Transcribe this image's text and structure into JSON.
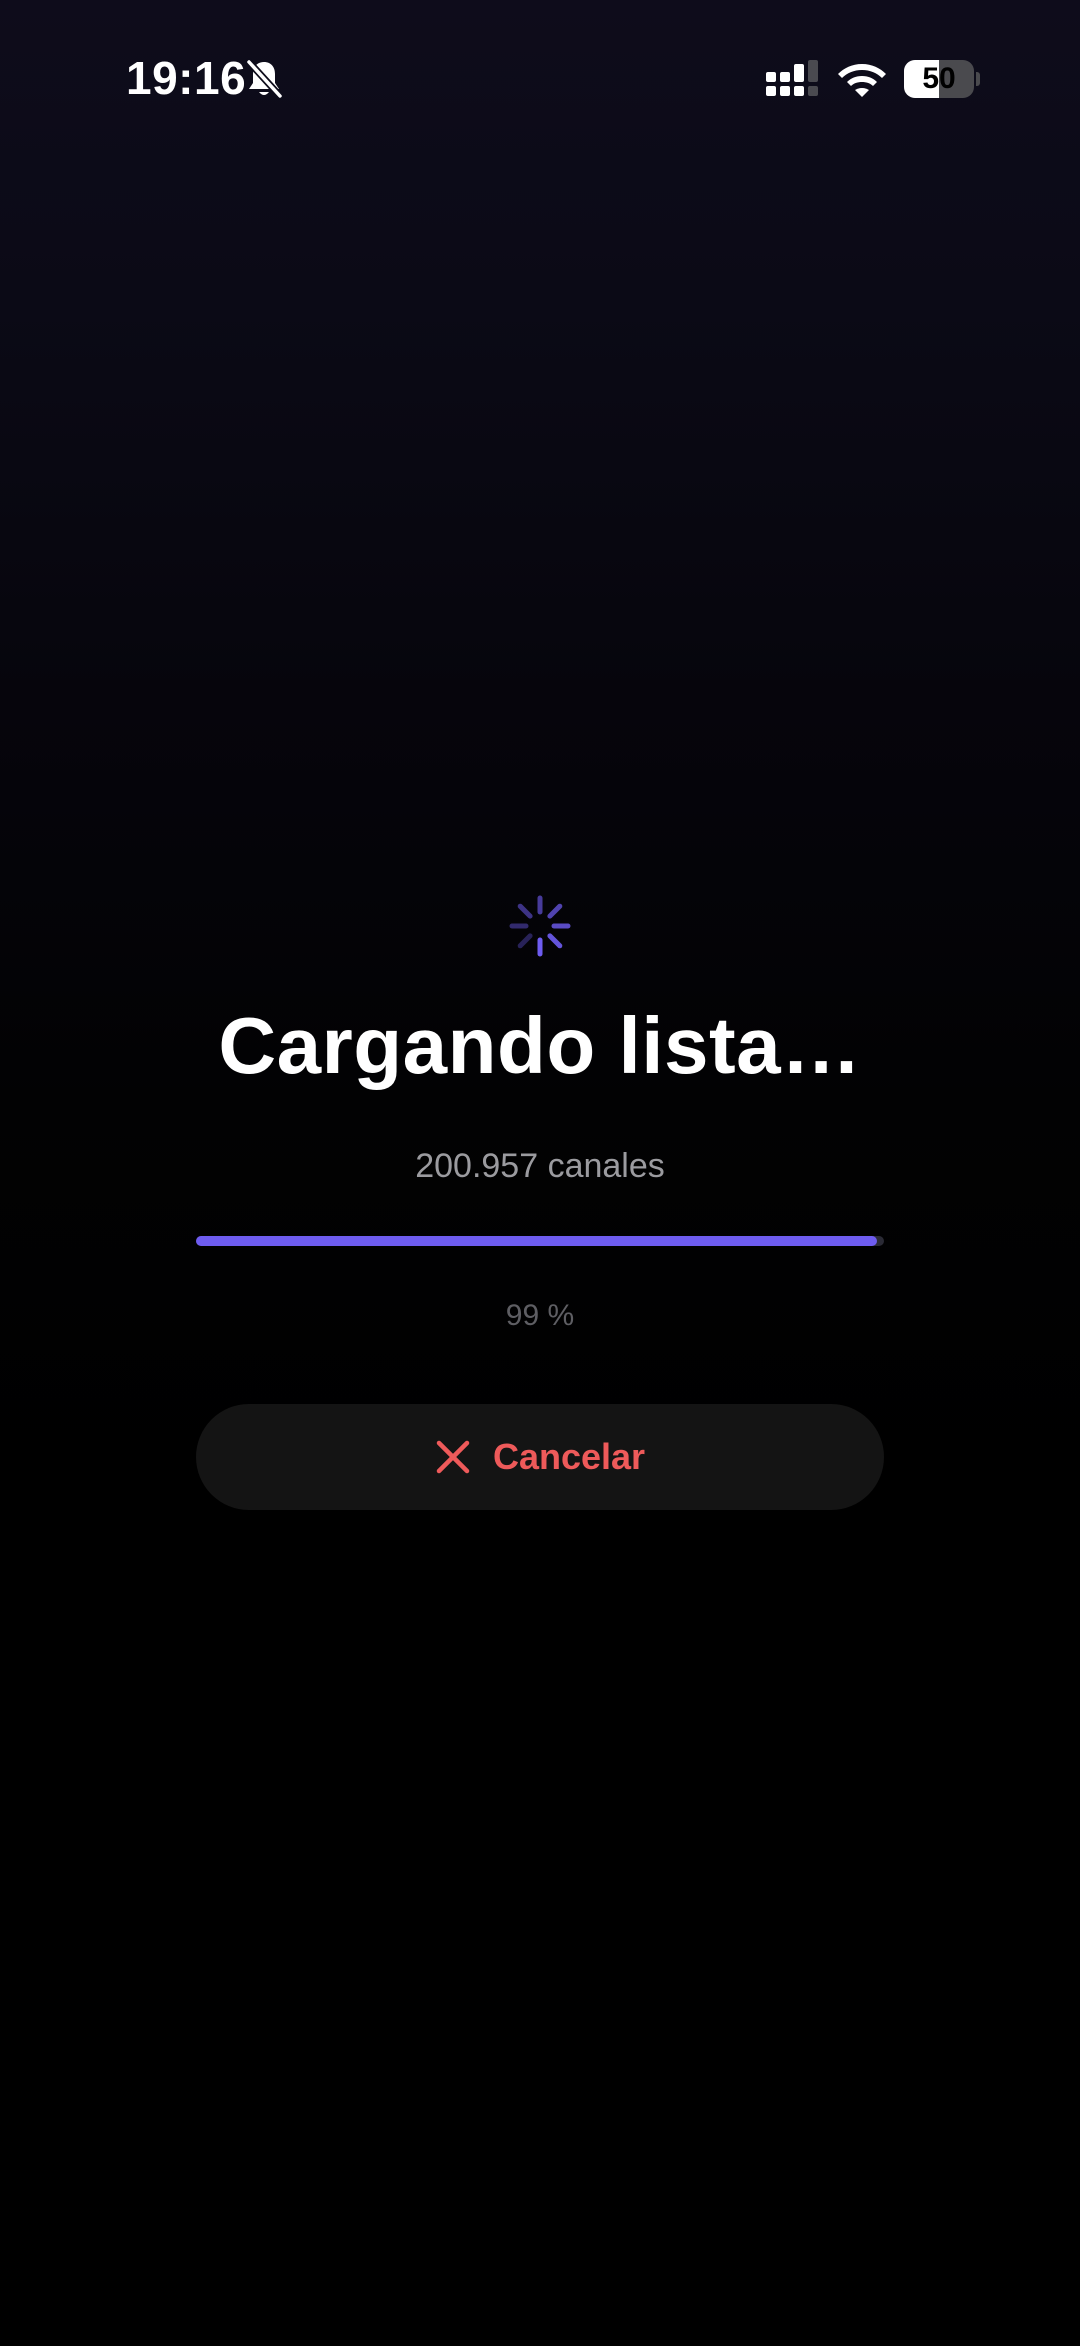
{
  "status_bar": {
    "time": "19:16",
    "battery_level": "50",
    "icons": [
      "bell-slash-icon",
      "cellular-signal-icon",
      "wifi-icon",
      "battery-icon"
    ]
  },
  "loading": {
    "spinner_icon": "activity-spinner-icon",
    "title": "Cargando lista…",
    "channel_count": "200.957 canales",
    "progress_fraction": 0.99,
    "percent_label": "99 %"
  },
  "cancel_button": {
    "icon": "close-icon",
    "label": "Cancelar"
  },
  "colors": {
    "accent": "#6e5cf0",
    "cancel": "#ee5a5a",
    "background_top": "#0e0c1b",
    "background_bottom": "#000000"
  }
}
